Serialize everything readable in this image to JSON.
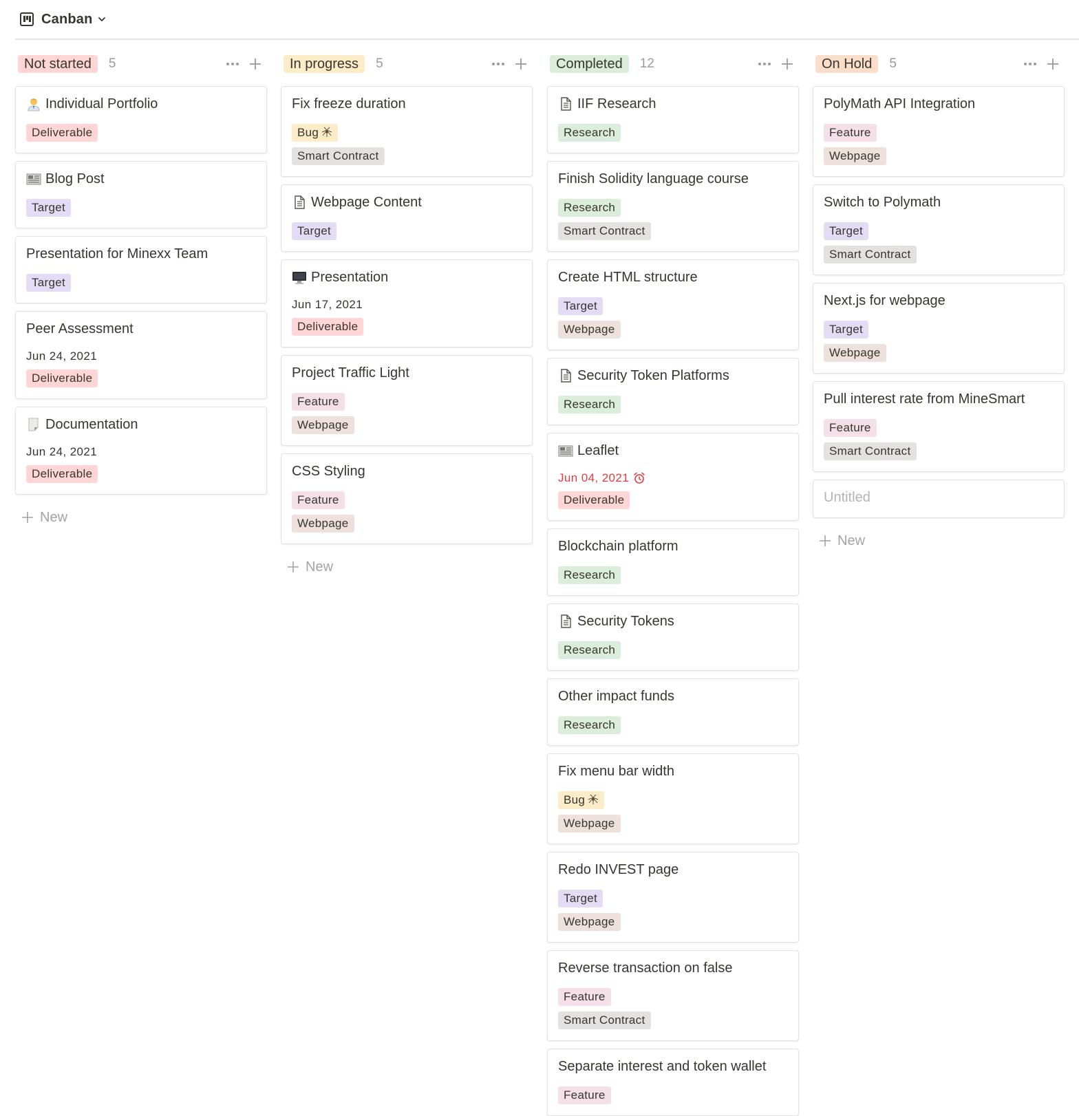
{
  "header": {
    "view_title": "Canban",
    "view_icon": "board-icon"
  },
  "colors": {
    "Not started": "#ffd5d5",
    "In progress": "#fdecc8",
    "Completed": "#dbeddb",
    "On Hold": "#fadec9",
    "Deliverable": "#ffd5d5",
    "Target": "#e3dcf4",
    "Bug": "#fdecc8",
    "Smart Contract": "#e3e2e0",
    "Research": "#dbeddb",
    "Feature": "#f5e0e9",
    "Webpage": "#eee0da"
  },
  "new_label": "New",
  "columns": [
    {
      "status": "Not started",
      "count": "5",
      "cards": [
        {
          "title": "Individual Portfolio",
          "icon": "person-emoji",
          "tags": [
            "Deliverable"
          ]
        },
        {
          "title": "Blog Post",
          "icon": "newspaper-emoji",
          "tags": [
            "Target"
          ]
        },
        {
          "title": "Presentation for Minexx Team",
          "tags": [
            "Target"
          ]
        },
        {
          "title": "Peer Assessment",
          "date": "Jun 24, 2021",
          "tags": [
            "Deliverable"
          ]
        },
        {
          "title": "Documentation",
          "icon": "page-curl-emoji",
          "date": "Jun 24, 2021",
          "tags": [
            "Deliverable"
          ]
        }
      ]
    },
    {
      "status": "In progress",
      "count": "5",
      "cards": [
        {
          "title": "Fix freeze duration",
          "tags": [
            "Bug",
            "Smart Contract"
          ]
        },
        {
          "title": "Webpage Content",
          "icon": "document-icon",
          "tags": [
            "Target"
          ]
        },
        {
          "title": "Presentation",
          "icon": "monitor-emoji",
          "date": "Jun 17, 2021",
          "tags": [
            "Deliverable"
          ]
        },
        {
          "title": "Project Traffic Light",
          "tags": [
            "Feature",
            "Webpage"
          ]
        },
        {
          "title": "CSS Styling",
          "tags": [
            "Feature",
            "Webpage"
          ]
        }
      ]
    },
    {
      "status": "Completed",
      "count": "12",
      "cards": [
        {
          "title": "IIF Research",
          "icon": "document-icon",
          "tags": [
            "Research"
          ]
        },
        {
          "title": "Finish Solidity language course",
          "tags": [
            "Research",
            "Smart Contract"
          ]
        },
        {
          "title": "Create HTML structure",
          "tags": [
            "Target",
            "Webpage"
          ]
        },
        {
          "title": "Security Token Platforms",
          "icon": "document-icon",
          "tags": [
            "Research"
          ]
        },
        {
          "title": "Leaflet",
          "icon": "newspaper-emoji",
          "date": "Jun 04, 2021",
          "overdue": true,
          "tags": [
            "Deliverable"
          ]
        },
        {
          "title": "Blockchain platform",
          "tags": [
            "Research"
          ]
        },
        {
          "title": "Security Tokens",
          "icon": "document-icon",
          "tags": [
            "Research"
          ]
        },
        {
          "title": "Other impact funds",
          "tags": [
            "Research"
          ]
        },
        {
          "title": "Fix menu bar width",
          "tags": [
            "Bug",
            "Webpage"
          ]
        },
        {
          "title": "Redo INVEST page",
          "tags": [
            "Target",
            "Webpage"
          ]
        },
        {
          "title": "Reverse transaction on false",
          "tags": [
            "Feature",
            "Smart Contract"
          ]
        },
        {
          "title": "Separate interest and token wallet",
          "tags": [
            "Feature"
          ]
        }
      ]
    },
    {
      "status": "On Hold",
      "count": "5",
      "cards": [
        {
          "title": "PolyMath API Integration",
          "tags": [
            "Feature",
            "Webpage"
          ]
        },
        {
          "title": "Switch to Polymath",
          "tags": [
            "Target",
            "Smart Contract"
          ]
        },
        {
          "title": "Next.js for webpage",
          "tags": [
            "Target",
            "Webpage"
          ]
        },
        {
          "title": "Pull interest rate from MineSmart",
          "tags": [
            "Feature",
            "Smart Contract"
          ]
        },
        {
          "title": "Untitled",
          "untitled": true,
          "tags": []
        }
      ]
    }
  ]
}
